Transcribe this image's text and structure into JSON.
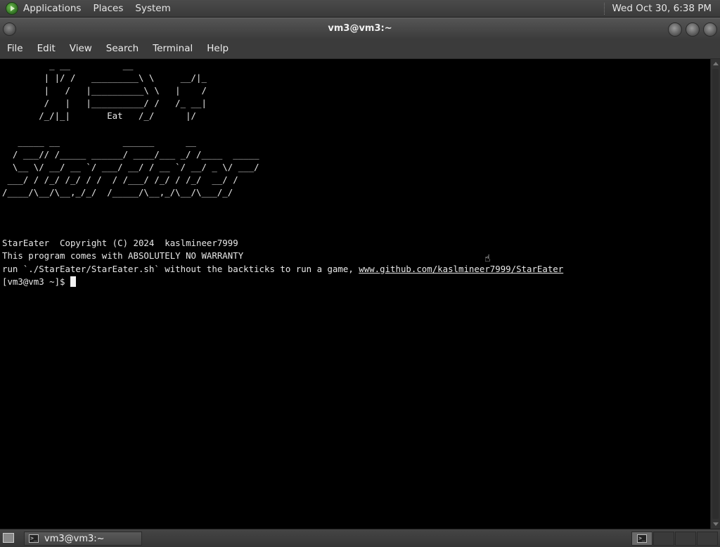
{
  "top_panel": {
    "menus": [
      "Applications",
      "Places",
      "System"
    ],
    "clock": "Wed Oct 30,  6:38 PM"
  },
  "window": {
    "title": "vm3@vm3:~"
  },
  "menubar": {
    "items": [
      "File",
      "Edit",
      "View",
      "Search",
      "Terminal",
      "Help"
    ]
  },
  "terminal": {
    "banner_lines": [
      "         _ __          __",
      "        | |/ /   _________\\ \\     __/|_",
      "        |   /   |__________\\ \\   |    /",
      "        /   |   |__________/ /   /_ __|",
      "       /_/|_|       Eat   /_/      |/",
      "",
      "   _____ __            ______      __",
      "  / ___// /_____ ______/ ____/___ _/ /____  _____",
      "  \\__ \\/ __/ __ `/ ___/ __/ / __ `/ __/ _ \\/ ___/",
      " ___/ / /_/ /_/ / /  / /___/ /_/ / /_/  __/ /",
      "/____/\\__/\\__,_/_/  /_____/\\__,_/\\__/\\___/_/",
      "",
      "",
      ""
    ],
    "copyright_line": "StarEater  Copyright (C) 2024  kaslmineer7999",
    "warranty_line": "This program comes with ABSOLUTELY NO WARRANTY",
    "run_line_text": "run `./StarEater/StarEater.sh` without the backticks to run a game, ",
    "run_line_link": "www.github.com/kaslmineer7999/StarEater",
    "prompt": "[vm3@vm3 ~]$ "
  },
  "taskbar": {
    "window_button_label": "vm3@vm3:~"
  },
  "icons": {
    "apps": "applications-icon",
    "terminal": "terminal-icon",
    "desktop": "show-desktop-icon"
  }
}
